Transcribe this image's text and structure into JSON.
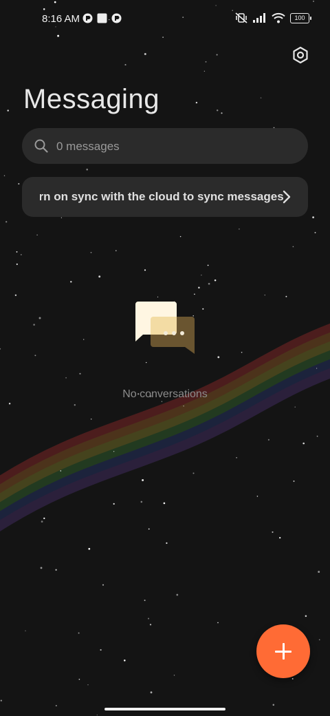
{
  "status_bar": {
    "time": "8:16 AM",
    "battery": "100",
    "icons": [
      "notification-app-icon",
      "square-notification-icon",
      "notification-app-icon",
      "mute-vibrate-icon",
      "signal-icon",
      "wifi-icon",
      "battery-icon"
    ]
  },
  "header": {
    "title": "Messaging",
    "settings_icon": "settings-icon"
  },
  "search": {
    "placeholder": "0 messages",
    "icon": "search-icon"
  },
  "sync_banner": {
    "text": "Turn on sync with the cloud to sync messages",
    "icon": "chevron-right-icon"
  },
  "empty_state": {
    "icon": "chat-bubbles-icon",
    "text": "No conversations"
  },
  "fab": {
    "icon": "plus-icon",
    "color": "#ff6b35"
  },
  "colors": {
    "background": "#141414",
    "surface": "#2b2b2b",
    "accent": "#ff6b35"
  }
}
